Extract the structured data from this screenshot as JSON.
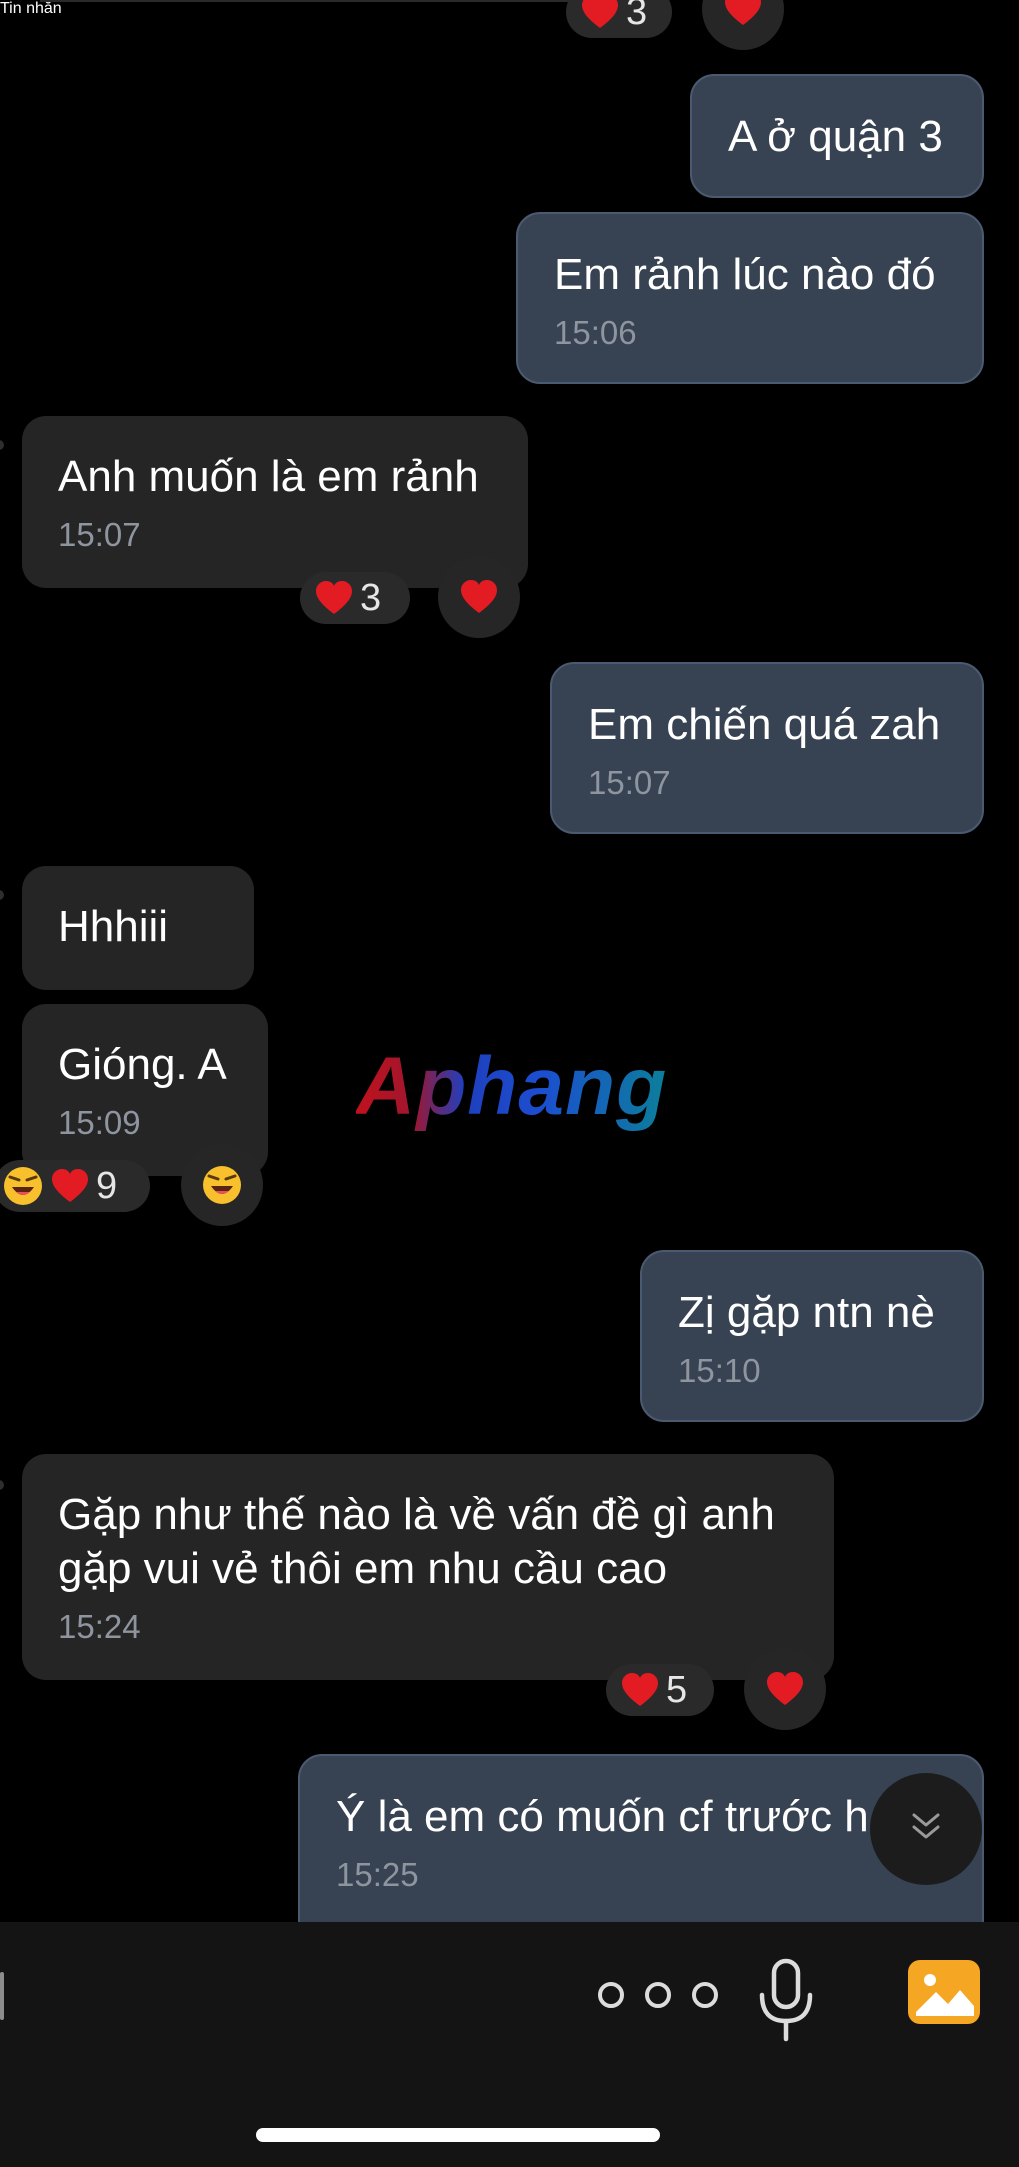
{
  "messages": [
    {
      "id": "m1",
      "dir": "out",
      "text": "A ở quận 3",
      "time": ""
    },
    {
      "id": "m2",
      "dir": "out",
      "text": "Em rảnh lúc nào đó",
      "time": "15:06"
    },
    {
      "id": "m3",
      "dir": "in",
      "text": "Anh muốn là em rảnh",
      "time": "15:07",
      "reaction_count": "3"
    },
    {
      "id": "m4",
      "dir": "out",
      "text": "Em chiến quá zah",
      "time": "15:07"
    },
    {
      "id": "m5",
      "dir": "in",
      "text": "Hhhiii",
      "time": ""
    },
    {
      "id": "m6",
      "dir": "in",
      "text": "Gióng. A",
      "time": "15:09",
      "reaction_count": "9"
    },
    {
      "id": "m7",
      "dir": "out",
      "text": "Zị gặp ntn nè",
      "time": "15:10"
    },
    {
      "id": "m8",
      "dir": "in",
      "text": "Gặp như thế nào là về vấn đề gì anh\ngặp vui vẻ thôi em nhu cầu cao",
      "time": "15:24",
      "reaction_count": "5"
    },
    {
      "id": "m9",
      "dir": "out",
      "text": "Ý là em có muốn cf trước h",
      "time": "15:25"
    }
  ],
  "top_reaction_count": "3",
  "watermark": "Aphang",
  "composer": {
    "placeholder": "Tin nhắn"
  },
  "icons": {
    "heart": "heart-icon",
    "laugh": "laughing-face-icon",
    "scroll_down": "chevron-double-down-icon",
    "more": "more-options-icon",
    "mic": "microphone-icon",
    "photo": "photo-gallery-icon"
  },
  "colors": {
    "background": "#000000",
    "incoming_bubble": "#252525",
    "outgoing_bubble": "#374252",
    "accent": "#f5a623"
  }
}
